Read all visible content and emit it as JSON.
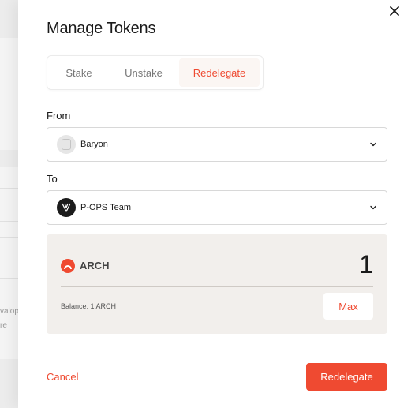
{
  "background": {
    "text_1": "valop",
    "text_2": "re"
  },
  "modal": {
    "title": "Manage Tokens",
    "close_icon": "close-icon",
    "tabs": [
      {
        "label": "Stake",
        "active": false
      },
      {
        "label": "Unstake",
        "active": false
      },
      {
        "label": "Redelegate",
        "active": true
      }
    ],
    "from": {
      "label": "From",
      "selected": "Baryon",
      "icon": "baryon-avatar"
    },
    "to": {
      "label": "To",
      "selected": "P-OPS Team",
      "icon": "pops-avatar"
    },
    "amount": {
      "token": "ARCH",
      "value": "1",
      "balance": "Balance: 1 ARCH",
      "max_label": "Max"
    },
    "actions": {
      "cancel_label": "Cancel",
      "submit_label": "Redelegate"
    }
  },
  "colors": {
    "accent": "#ef4a31",
    "card_bg": "#f2efec",
    "active_tab_bg": "#fbf6f3"
  }
}
